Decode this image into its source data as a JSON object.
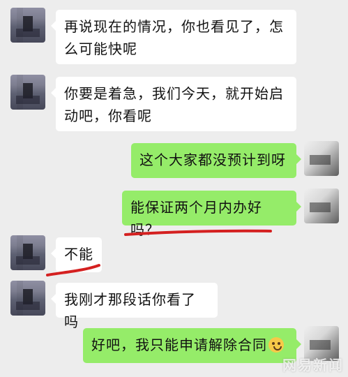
{
  "messages": [
    {
      "side": "left",
      "text_line1": "再说现在的情况，你也看见了，怎",
      "text_line2": "么可能快呢"
    },
    {
      "side": "left",
      "text_line1": "你要是着急，我们今天，就开始启",
      "text_line2": "动吧，你看呢"
    },
    {
      "side": "right",
      "text": "这个大家都没预计到呀"
    },
    {
      "side": "right",
      "text": "能保证两个月内办好吗？"
    },
    {
      "side": "left",
      "text": "不能"
    },
    {
      "side": "left",
      "text": "我刚才那段话你看了吗"
    },
    {
      "side": "right",
      "text": "好吧，我只能申请解除合同",
      "emoji": "grinning-sweat-emoji"
    }
  ],
  "annotations": {
    "underline_color": "#d42020"
  },
  "watermark": {
    "text": "网易新闻"
  }
}
